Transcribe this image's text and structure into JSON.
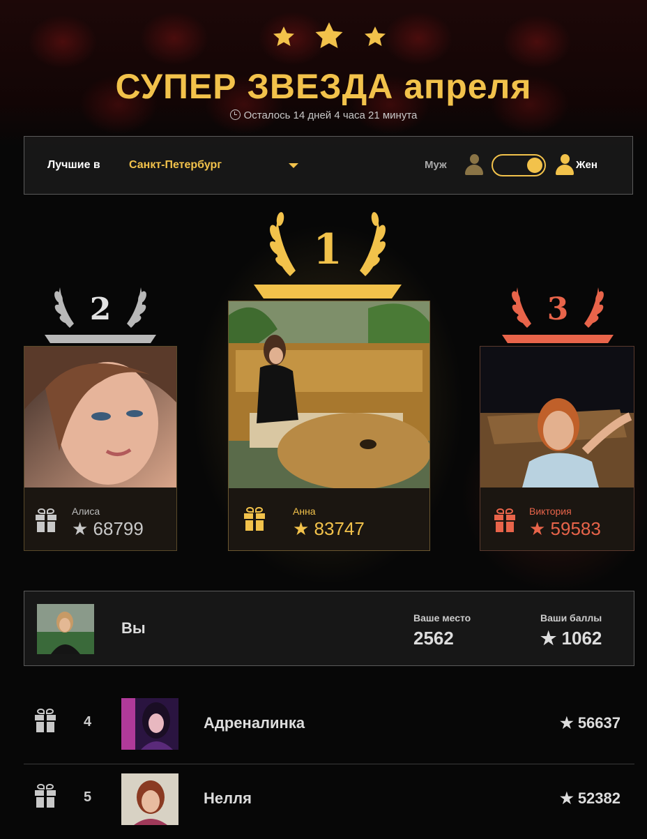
{
  "header": {
    "title": "СУПЕР ЗВЕЗДА апреля",
    "timer": "Осталось 14 дней 4 часа 21 минута"
  },
  "filter": {
    "best_label": "Лучшие в",
    "city": "Санкт-Петербург",
    "male_label": "Муж",
    "female_label": "Жен",
    "selected_gender": "Жен"
  },
  "podium": [
    {
      "place": "2",
      "name": "Алиса",
      "score": "68799"
    },
    {
      "place": "1",
      "name": "Анна",
      "score": "83747"
    },
    {
      "place": "3",
      "name": "Виктория",
      "score": "59583"
    }
  ],
  "you": {
    "label": "Вы",
    "place_label": "Ваше место",
    "place": "2562",
    "points_label": "Ваши баллы",
    "points": "1062"
  },
  "rows": [
    {
      "rank": "4",
      "name": "Адреналинка",
      "score": "56637"
    },
    {
      "rank": "5",
      "name": "Нелля",
      "score": "52382"
    }
  ],
  "colors": {
    "gold": "#f2c24b",
    "silver": "#c8c8c8",
    "bronze": "#e8644a"
  }
}
